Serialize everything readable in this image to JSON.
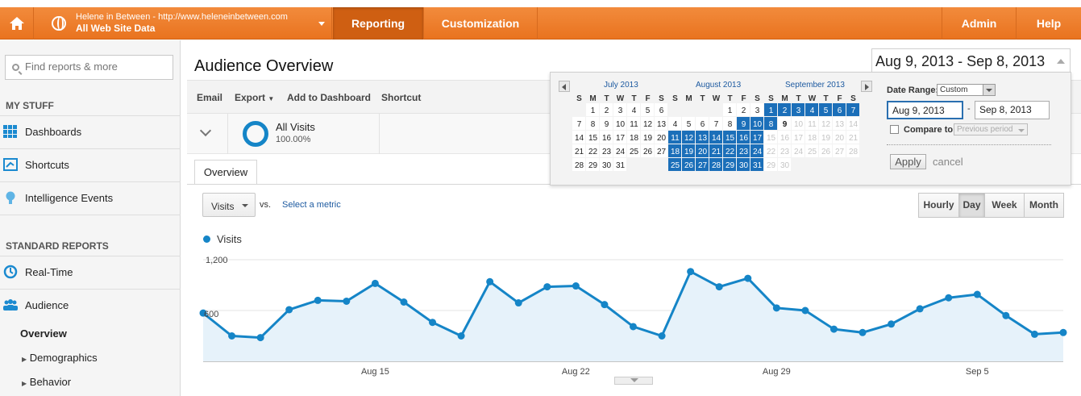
{
  "topbar": {
    "account_url": "Helene in Between - http://www.heleneinbetween.com",
    "account_view": "All Web Site Data",
    "nav": [
      "Reporting",
      "Customization",
      "Admin",
      "Help"
    ]
  },
  "sidebar": {
    "search_placeholder": "Find reports & more",
    "my_stuff_title": "MY STUFF",
    "my_stuff": [
      "Dashboards",
      "Shortcuts",
      "Intelligence Events"
    ],
    "standard_title": "STANDARD REPORTS",
    "standard": [
      "Real-Time",
      "Audience"
    ],
    "sub": [
      "Overview",
      "Demographics",
      "Behavior"
    ]
  },
  "main": {
    "title": "Audience Overview",
    "toolbar": [
      "Email",
      "Export",
      "Add to Dashboard",
      "Shortcut"
    ],
    "segment": {
      "name": "All Visits",
      "pct": "100.00%"
    },
    "tab": "Overview",
    "metric": "Visits",
    "vs": "vs.",
    "select_metric": "Select a metric",
    "granularity": [
      "Hourly",
      "Day",
      "Week",
      "Month"
    ],
    "granularity_active": "Day",
    "legend": "Visits"
  },
  "daterange": {
    "display": "Aug 9, 2013 - Sep 8, 2013",
    "label": "Date Range:",
    "mode": "Custom",
    "start": "Aug 9, 2013",
    "dash": "-",
    "end": "Sep 8, 2013",
    "compare_label": "Compare to:",
    "compare_value": "Previous period",
    "apply": "Apply",
    "cancel": "cancel",
    "months": [
      "July 2013",
      "August 2013",
      "September 2013"
    ],
    "weekdays": [
      "S",
      "M",
      "T",
      "W",
      "T",
      "F",
      "S"
    ]
  },
  "colors": {
    "orange": "#ec7a2a",
    "blue": "#1585c7",
    "selected": "#1b6fb9"
  },
  "chart_data": {
    "type": "area",
    "series": [
      {
        "name": "Visits",
        "values": [
          570,
          300,
          280,
          610,
          720,
          710,
          920,
          700,
          460,
          300,
          940,
          690,
          880,
          890,
          670,
          410,
          300,
          1060,
          880,
          980,
          630,
          600,
          380,
          340,
          440,
          620,
          750,
          790,
          540,
          320,
          340
        ]
      }
    ],
    "x_tick_labels": [
      "Aug 15",
      "Aug 22",
      "Aug 29",
      "Sep 5"
    ],
    "y_tick_labels": [
      "1,200",
      "600"
    ],
    "ylim": [
      0,
      1200
    ]
  }
}
